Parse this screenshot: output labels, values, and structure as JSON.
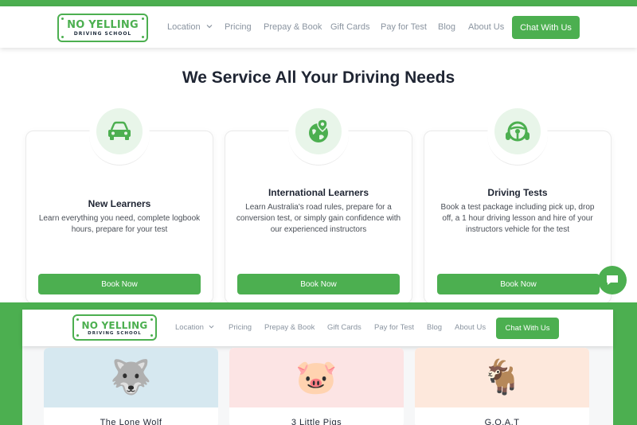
{
  "header": {
    "logo": {
      "main": "NO YELLING",
      "sub": "DRIVING SCHOOL"
    },
    "nav": [
      {
        "label": "Location",
        "has_dropdown": true
      },
      {
        "label": "Pricing"
      },
      {
        "label": "Prepay & Book"
      },
      {
        "label": "Gift Cards"
      },
      {
        "label": "Pay for Test"
      },
      {
        "label": "Blog"
      },
      {
        "label": "About Us"
      }
    ],
    "cta": "Chat With Us"
  },
  "section_title": "We Service All Your Driving Needs",
  "cards": [
    {
      "icon": "car-icon",
      "title": "New Learners",
      "desc": "Learn everything you need, complete logbook hours, prepare for your test",
      "button": "Book Now"
    },
    {
      "icon": "globe-pin-icon",
      "title": "International Learners",
      "desc": "Learn Australia's road rules, prepare for a conversion test, or simply gain confidence with our experienced instructors",
      "button": "Book Now"
    },
    {
      "icon": "steering-wheel-icon",
      "title": "Driving Tests",
      "desc": "Book a test package including pick up, drop off, a 1 hour driving lesson and hire of your instructors vehicle for the test",
      "button": "Book Now"
    }
  ],
  "chat_widget_icon": "chat-bubble-icon",
  "overlay": {
    "header": {
      "logo": {
        "main": "NO YELLING",
        "sub": "DRIVING SCHOOL"
      },
      "nav": [
        {
          "label": "Location",
          "has_dropdown": true
        },
        {
          "label": "Pricing"
        },
        {
          "label": "Prepay & Book"
        },
        {
          "label": "Gift Cards"
        },
        {
          "label": "Pay for Test"
        },
        {
          "label": "Blog"
        },
        {
          "label": "About Us"
        }
      ],
      "cta": "Chat With Us"
    },
    "animal_cards": [
      {
        "name": "The Lone Wolf",
        "emoji": "🐺",
        "bg": "#d6e8f0"
      },
      {
        "name": "3 Little Pigs",
        "emoji": "🐷",
        "bg": "#fce4e4"
      },
      {
        "name": "G.O.A.T",
        "emoji": "🐐",
        "bg": "#fde8dc"
      }
    ]
  },
  "colors": {
    "brand_green": "#4caf50",
    "dark_text": "#1f2533",
    "nav_text": "#8a94a0"
  }
}
